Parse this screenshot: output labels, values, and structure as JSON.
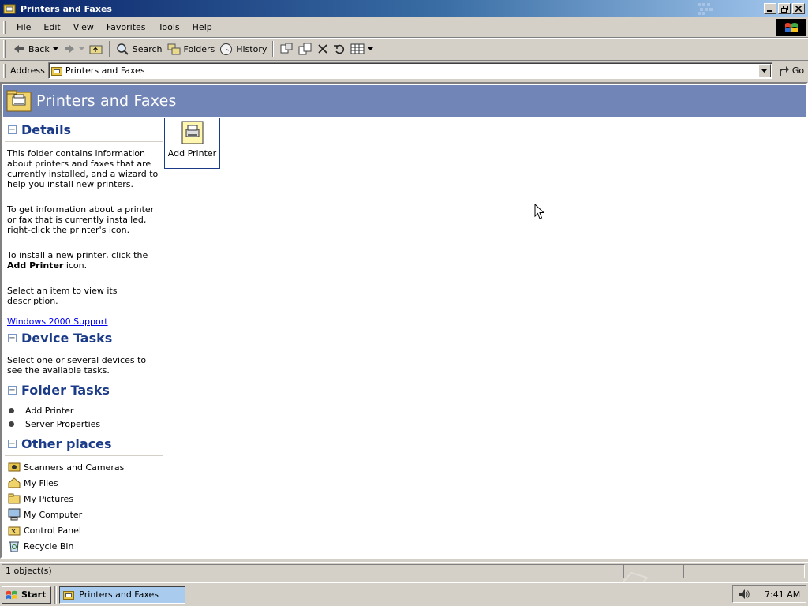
{
  "window": {
    "title": "Printers and Faxes"
  },
  "menu": {
    "items": [
      "File",
      "Edit",
      "View",
      "Favorites",
      "Tools",
      "Help"
    ]
  },
  "toolbar": {
    "back_label": "Back",
    "search_label": "Search",
    "folders_label": "Folders",
    "history_label": "History"
  },
  "address": {
    "label": "Address",
    "value": "Printers and Faxes",
    "go_label": "Go"
  },
  "banner": {
    "title": "Printers and Faxes"
  },
  "details": {
    "title": "Details",
    "toggle": "−",
    "para1": "This folder contains information about printers and faxes that are currently installed, and a wizard to help you install new printers.",
    "para2": "To get information about a printer or fax that is currently installed, right-click the printer's icon.",
    "para3_pre": "To install a new printer, click the ",
    "para3_bold": "Add Printer",
    "para3_post": " icon.",
    "para4": "Select an item to view its description.",
    "support_link": "Windows 2000 Support"
  },
  "device_tasks": {
    "title": "Device Tasks",
    "toggle": "−",
    "text": "Select one or several devices to see the available tasks."
  },
  "folder_tasks": {
    "title": "Folder Tasks",
    "toggle": "−",
    "items": [
      "Add Printer",
      "Server Properties"
    ]
  },
  "other_places": {
    "title": "Other places",
    "toggle": "−",
    "items": [
      {
        "label": "Scanners and Cameras",
        "icon": "scanner-icon"
      },
      {
        "label": "My Files",
        "icon": "my-files-icon"
      },
      {
        "label": "My Pictures",
        "icon": "folder-icon"
      },
      {
        "label": "My Computer",
        "icon": "computer-icon"
      },
      {
        "label": "Control Panel",
        "icon": "control-panel-icon"
      },
      {
        "label": "Recycle Bin",
        "icon": "recycle-bin-icon"
      }
    ]
  },
  "content": {
    "items": [
      {
        "label": "Add Printer",
        "icon": "add-printer-icon",
        "selected": true
      }
    ]
  },
  "status": {
    "text": "1 object(s)"
  },
  "taskbar": {
    "start_label": "Start",
    "task_label": "Printers and Faxes",
    "clock": "7:41 AM"
  },
  "colors": {
    "title_gradient_start": "#0a246a",
    "banner": "#7285b7",
    "section_title": "#1b3b88",
    "link": "#0000ee",
    "chrome": "#d4d0c8"
  }
}
